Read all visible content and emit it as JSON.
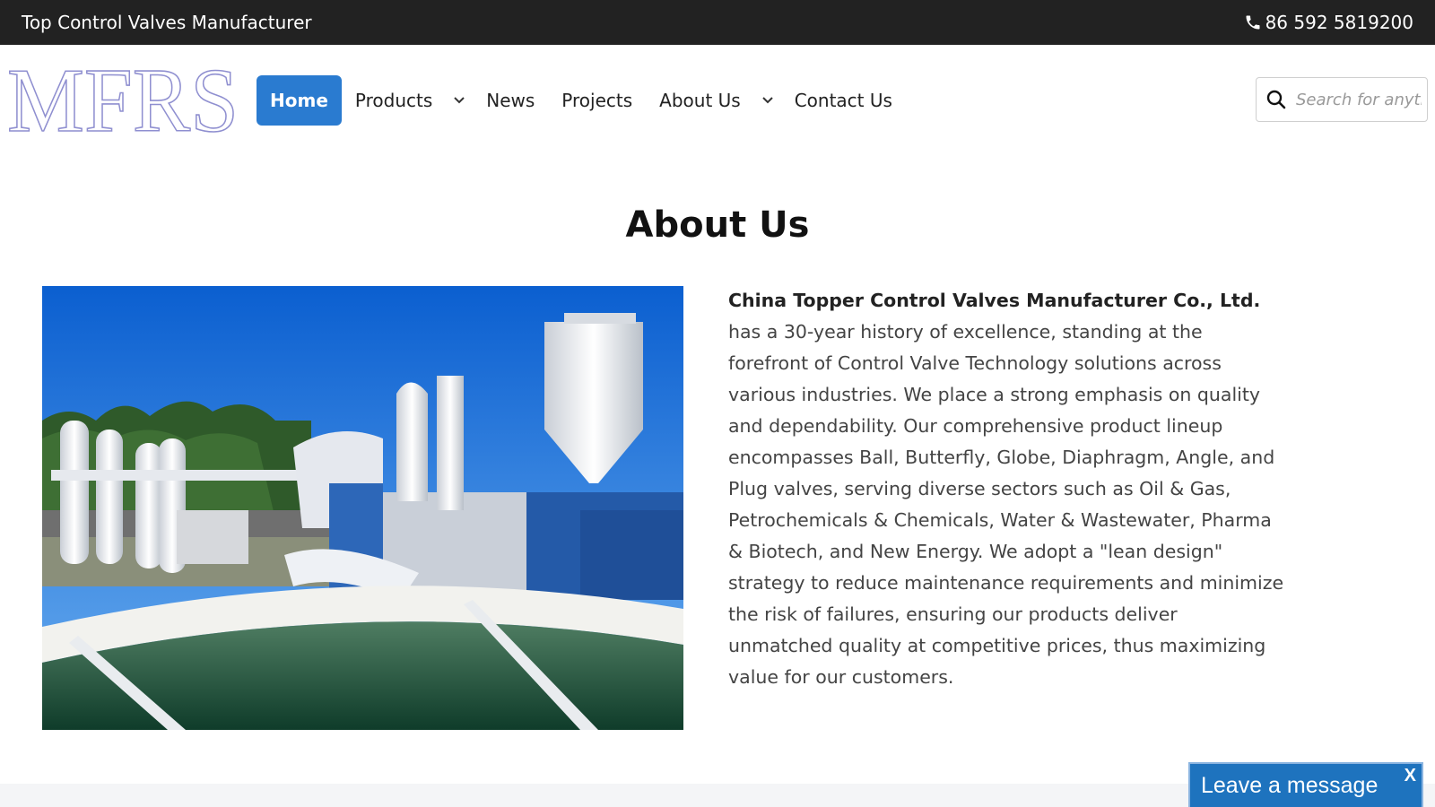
{
  "topbar": {
    "tagline": "Top Control Valves Manufacturer",
    "phone": "86 592 5819200",
    "phone_icon": "phone-icon",
    "background": "#222222"
  },
  "logo": {
    "text": "MFRS",
    "color": "#8f8fd0"
  },
  "nav": {
    "home": "Home",
    "products": "Products",
    "news": "News",
    "projects": "Projects",
    "about": "About Us",
    "contact": "Contact Us",
    "dropdown_icon": "chevron-down-icon",
    "active_color": "#2a7bd0"
  },
  "search": {
    "placeholder": "Search for anything",
    "icon": "search-icon"
  },
  "about": {
    "title": "About Us",
    "company": "China Topper Control Valves Manufacturer Co., Ltd.",
    "body": "has a 30-year history of excellence, standing at the forefront of Control Valve Technology solutions across various industries. We place a strong emphasis on quality and dependability. Our comprehensive product lineup encompasses Ball, Butterfly, Globe, Diaphragm, Angle, and Plug valves, serving diverse sectors such as Oil & Gas, Petrochemicals & Chemicals, Water & Wastewater, Pharma & Biotech, and New Energy. We adopt a \"lean design\" strategy to reduce maintenance requirements and minimize the risk of failures, ensuring our products deliver unmatched quality at competitive prices, thus maximizing value for our customers."
  },
  "chat": {
    "label": "Leave a message",
    "close": "X",
    "color": "#1e73be"
  }
}
